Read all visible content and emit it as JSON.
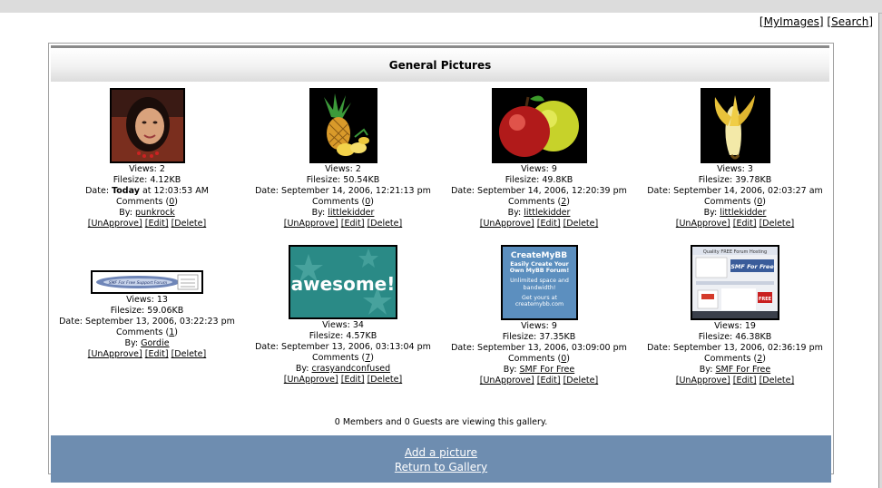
{
  "top_links": {
    "my_images": "[MyImages]",
    "search": "[Search]"
  },
  "gallery_title": "General Pictures",
  "labels": {
    "views": "Views:",
    "filesize": "Filesize:",
    "date": "Date:",
    "comments": "Comments",
    "by": "By:",
    "unapprove": "[UnApprove]",
    "edit": "[Edit]",
    "delete": "[Delete]"
  },
  "pictures": [
    {
      "views": "2",
      "filesize": "4.12KB",
      "date_bold": "Today",
      "date": " at 12:03:53 AM",
      "comments": "0",
      "author": "punkrock",
      "thumb": "woman-portrait"
    },
    {
      "views": "2",
      "filesize": "50.54KB",
      "date_bold": "",
      "date": "September 14, 2006, 12:21:13 pm",
      "comments": "0",
      "author": "littlekidder",
      "thumb": "pineapple"
    },
    {
      "views": "9",
      "filesize": "49.8KB",
      "date_bold": "",
      "date": "September 14, 2006, 12:20:39 pm",
      "comments": "2",
      "author": "littlekidder",
      "thumb": "apples"
    },
    {
      "views": "3",
      "filesize": "39.78KB",
      "date_bold": "",
      "date": "September 14, 2006, 02:03:27 am",
      "comments": "0",
      "author": "littlekidder",
      "thumb": "banana"
    },
    {
      "views": "13",
      "filesize": "59.06KB",
      "date_bold": "",
      "date": "September 13, 2006, 03:22:23 pm",
      "comments": "1",
      "author": "Gordie",
      "thumb": "forum-banner"
    },
    {
      "views": "34",
      "filesize": "4.57KB",
      "date_bold": "",
      "date": "September 13, 2006, 03:13:04 pm",
      "comments": "7",
      "author": "crasyandconfused",
      "thumb": "awesome-banner"
    },
    {
      "views": "9",
      "filesize": "37.35KB",
      "date_bold": "",
      "date": "September 13, 2006, 03:09:00 pm",
      "comments": "0",
      "author": "SMF For Free",
      "thumb": "createmybb-ad"
    },
    {
      "views": "19",
      "filesize": "46.38KB",
      "date_bold": "",
      "date": "September 13, 2006, 02:36:19 pm",
      "comments": "2",
      "author": "SMF For Free",
      "thumb": "smf-hosting-ad"
    }
  ],
  "thumb_text": {
    "forum_banner": "SMF For Free Support Forum",
    "awesome": "awesome!",
    "createmybb_logo": "CreateMyBB",
    "createmybb_line1": "Easily Create Your Own MyBB Forum!",
    "createmybb_line2": "Unlimited space and bandwidth!",
    "createmybb_line3": "Get yours at createmybb.com",
    "smf_header": "Quality FREE Forum Hosting",
    "smf_logo": "SMF For Free",
    "smf_free": "FREE"
  },
  "viewers_text": "0 Members and 0 Guests are viewing this gallery.",
  "bottom_links": {
    "add": "Add a picture",
    "return": "Return to Gallery"
  },
  "colors": {
    "bottom_bar": "#6e8db0",
    "awesome_bg": "#2a8a86",
    "createmybb_bg": "#5c8fbf"
  }
}
